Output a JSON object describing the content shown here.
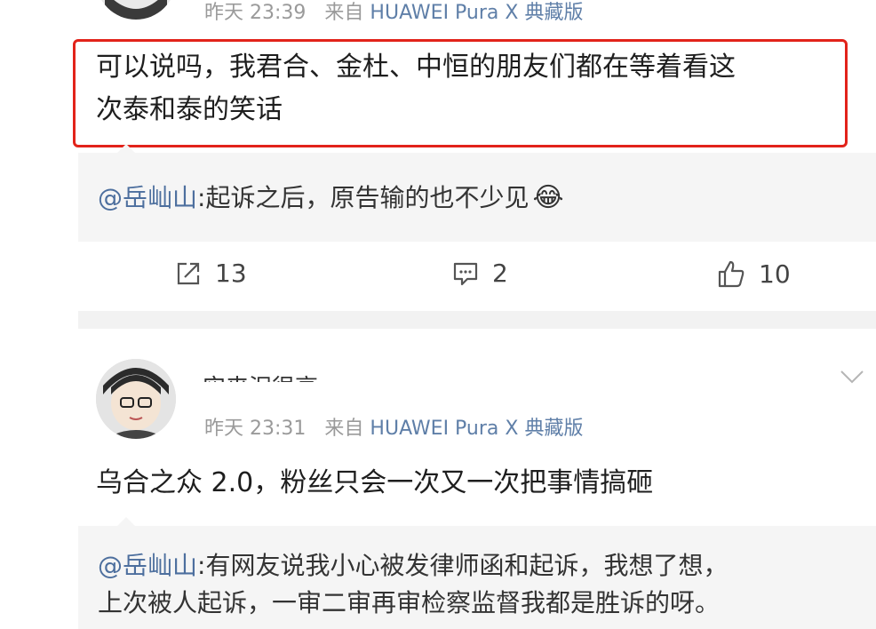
{
  "comment1": {
    "time": "昨天 23:39",
    "from_label": "来自",
    "device": "HUAWEI Pura X 典藏版",
    "text_line1": "可以说吗，我君合、金杜、中恒的朋友们都在等着看这",
    "text_line2": "次泰和泰的笑话",
    "quote": {
      "mention": "@岳屾山",
      "text": ":起诉之后，原告输的也不少见",
      "emoji": "😂"
    },
    "actions": {
      "repost_count": "13",
      "comment_count": "2",
      "like_count": "10"
    }
  },
  "comment2": {
    "username": "实来泥很高",
    "time": "昨天 23:31",
    "from_label": "来自",
    "device": "HUAWEI Pura X 典藏版",
    "text": "乌合之众 2.0，粉丝只会一次又一次把事情搞砸",
    "quote": {
      "mention": "@岳屾山",
      "text_line1": ":有网友说我小心被发律师函和起诉，我想了想，",
      "text_line2": "上次被人起诉，一审二审再审检察监督我都是胜诉的呀。"
    }
  },
  "colors": {
    "highlight_border": "#e2231a",
    "link": "#4d6f9e",
    "meta_gray": "#9a9a9a",
    "quote_bg": "#f5f5f5",
    "divider_bg": "#f2f2f2"
  }
}
